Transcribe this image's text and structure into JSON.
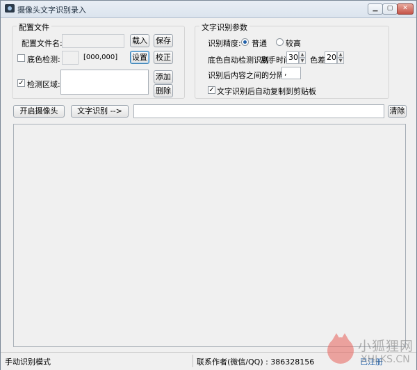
{
  "window": {
    "title": "摄像头文字识别录入"
  },
  "config_group": {
    "title": "配置文件",
    "config_file_label": "配置文件名:",
    "config_file_value": "",
    "load_button": "载入",
    "save_button": "保存",
    "bg_detect_label": "底色检测:",
    "bg_detect_checked": false,
    "bg_color_value": "",
    "bg_color_rgb": "[000,000]",
    "set_button": "设置",
    "correct_button": "校正",
    "detect_area_label": "检测区域:",
    "detect_area_checked": true,
    "add_button": "添加",
    "delete_button": "删除"
  },
  "ocr_group": {
    "title": "文字识别参数",
    "precision_label": "识别精度:",
    "precision_options": [
      "普通",
      "较高"
    ],
    "precision_selected": "普通",
    "auto_detect_label": "底色自动检测识别:",
    "leave_time_label": "离手时间",
    "leave_time_value": "30",
    "color_diff_label": "色差",
    "color_diff_value": "20",
    "separator_label": "识别后内容之间的分隔符:",
    "separator_value": ",",
    "auto_copy_label": "文字识别后自动复制到剪贴板",
    "auto_copy_checked": true
  },
  "toolbar": {
    "open_camera_button": "开启摄像头",
    "recognize_button": "文字识别 -->",
    "result_value": "",
    "clear_button": "清除"
  },
  "status": {
    "mode": "手动识别模式",
    "contact": "联系作者(微信/QQ) : 386328156",
    "registration": "已注册"
  },
  "watermark": {
    "text": "小狐狸网",
    "sub": "XHLKS.CN"
  },
  "colors": {
    "accent": "#1f5fa8",
    "registered": "#1f5fa8",
    "watermark": "#e7625b"
  }
}
